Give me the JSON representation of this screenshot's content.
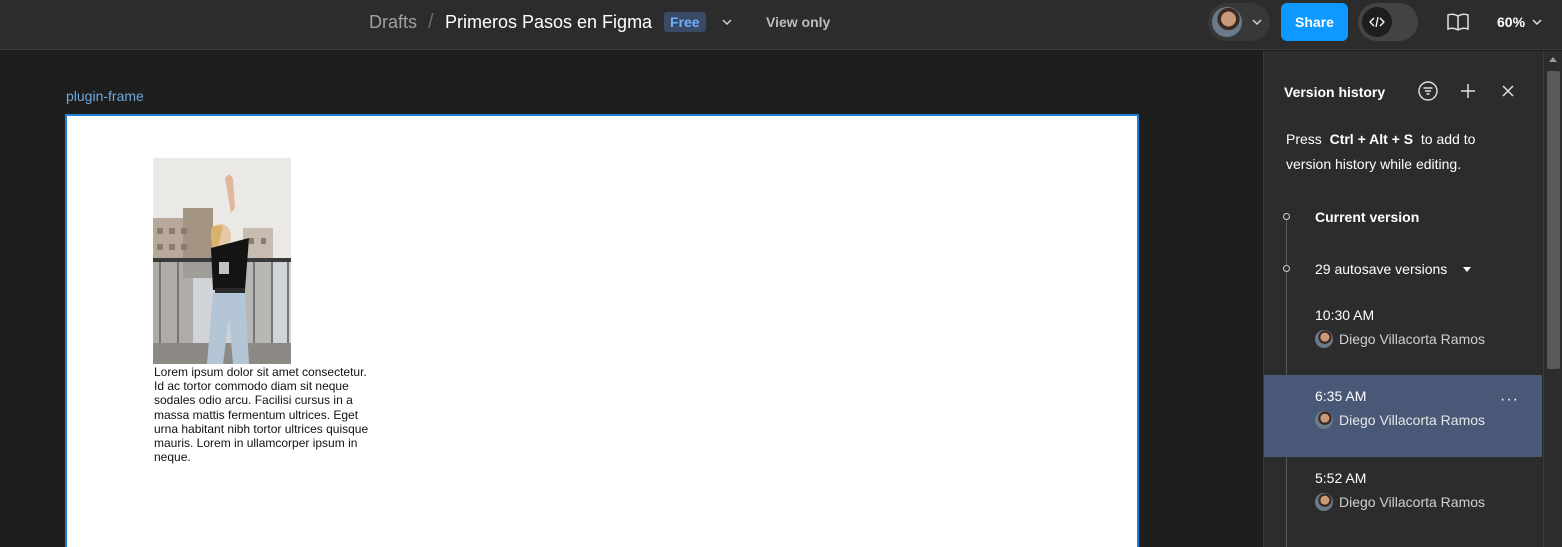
{
  "header": {
    "breadcrumb_root": "Drafts",
    "breadcrumb_separator": "/",
    "file_title": "Primeros Pasos en Figma",
    "plan_badge": "Free",
    "view_mode": "View only",
    "share_label": "Share",
    "zoom": "60%",
    "accent_color": "#0d99ff"
  },
  "canvas": {
    "frame_label": "plugin-frame",
    "body_text": "Lorem ipsum dolor sit amet consectetur. Id ac tortor commodo diam sit neque sodales odio arcu. Facilisi cursus in a massa mattis fermentum ultrices. Eget urna habitant nibh tortor ultrices quisque mauris. Lorem in ullamcorper ipsum in neque."
  },
  "version_history": {
    "title": "Version history",
    "hint_prefix": "Press",
    "hint_shortcut": "Ctrl + Alt + S",
    "hint_suffix": "to add to version history while editing.",
    "current_version_label": "Current version",
    "autosave_label": "29 autosave versions",
    "versions": [
      {
        "time": "10:30 AM",
        "author": "Diego Villacorta Ramos",
        "selected": false
      },
      {
        "time": "6:35 AM",
        "author": "Diego Villacorta Ramos",
        "selected": true
      },
      {
        "time": "5:52 AM",
        "author": "Diego Villacorta Ramos",
        "selected": false
      }
    ],
    "more_label": "···",
    "selected_color": "#4a5878"
  },
  "icons": {
    "title_menu": "chevron-down-icon",
    "dev_mode": "code-icon",
    "resources": "book-icon",
    "filter": "filter-icon",
    "add": "plus-icon",
    "close": "close-icon"
  }
}
